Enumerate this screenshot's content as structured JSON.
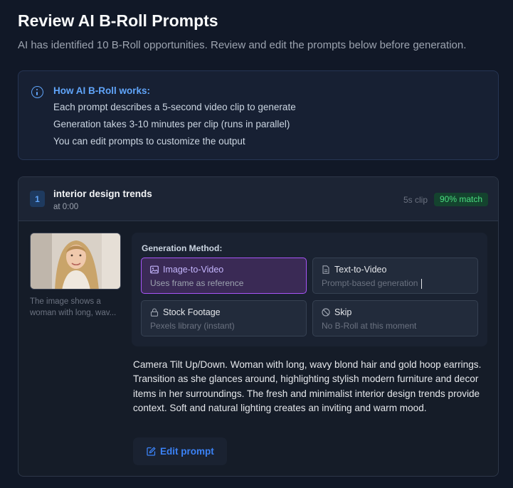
{
  "page": {
    "title": "Review AI B-Roll Prompts",
    "subtitle": "AI has identified 10 B-Roll opportunities. Review and edit the prompts below before generation."
  },
  "info": {
    "icon": "info-icon",
    "title": "How AI B-Roll works:",
    "lines": [
      "Each prompt describes a 5-second video clip to generate",
      "Generation takes 3-10 minutes per clip (runs in parallel)",
      "You can edit prompts to customize the output"
    ]
  },
  "segment": {
    "number": "1",
    "title": "interior design trends",
    "time": "at 0:00",
    "clip_length": "5s clip",
    "match": "90% match",
    "thumbnail_caption": "The image shows a woman with long, wav...",
    "generation_label": "Generation Method:",
    "options": [
      {
        "title": "Image-to-Video",
        "subtitle": "Uses frame as reference",
        "icon": "image-icon",
        "selected": true
      },
      {
        "title": "Text-to-Video",
        "subtitle": "Prompt-based generation",
        "icon": "document-icon",
        "selected": false
      },
      {
        "title": "Stock Footage",
        "subtitle": "Pexels library (instant)",
        "icon": "lock-icon",
        "selected": false
      },
      {
        "title": "Skip",
        "subtitle": "No B-Roll at this moment",
        "icon": "ban-icon",
        "selected": false
      }
    ],
    "prompt": "Camera Tilt Up/Down. Woman with long, wavy blond hair and gold hoop earrings. Transition as she glances around, highlighting stylish modern furniture and decor items in her surroundings. The fresh and minimalist interior design trends provide context. Soft and natural lighting creates an inviting and warm mood.",
    "edit_label": "Edit prompt"
  },
  "colors": {
    "background": "#111827",
    "accent_blue": "#60a5fa",
    "accent_purple": "#a855f7",
    "match_green": "#4ade80"
  }
}
